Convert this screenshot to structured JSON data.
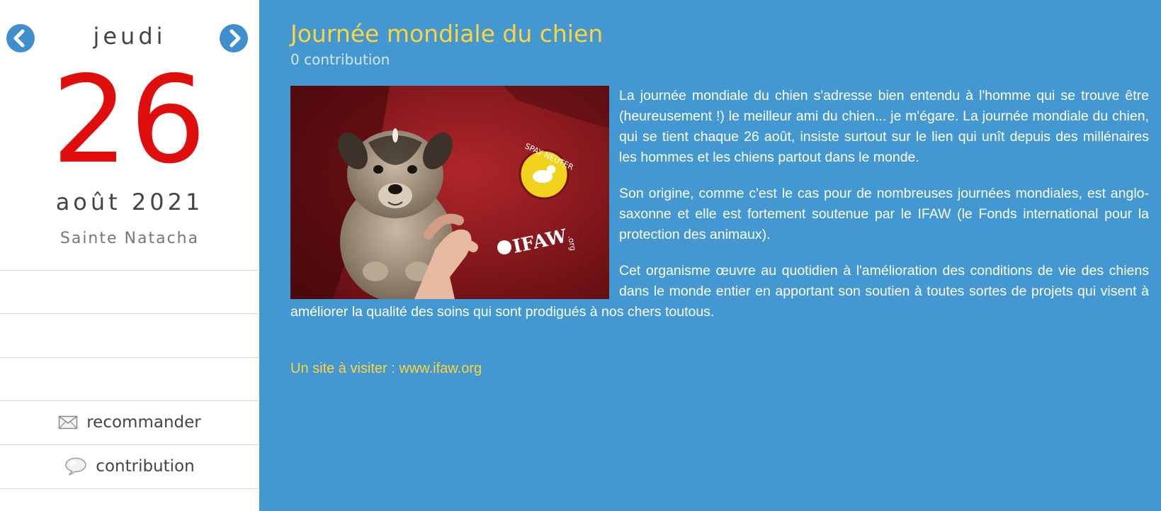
{
  "sidebar": {
    "weekday": "jeudi",
    "day": "26",
    "month_year": "août 2021",
    "saint": "Sainte Natacha",
    "actions": {
      "recommend": "recommander",
      "contribute": "contribution"
    }
  },
  "article": {
    "title": "Journée mondiale du chien",
    "contributions": "0 contribution",
    "paragraphs": [
      "La journée mondiale du chien s'adresse bien entendu à l'homme qui se trouve être (heureusement !) le meilleur ami du chien... je m'égare. La journée mondiale du chien, qui se tient chaque 26 août, insiste surtout sur le lien qui unît depuis des millénaires les hommes et les chiens partout dans le monde.",
      "Son origine, comme c'est le cas pour de nombreuses journées mondiales, est anglo-saxonne et elle est fortement soutenue par le IFAW (le Fonds international pour la protection des animaux).",
      "Cet organisme œuvre au quotidien à l'amélioration des conditions de vie des chiens dans le monde entier en apportant son soutien à toutes sortes de projets qui visent à améliorer la qualité des soins qui sont prodigués à nos chers toutous."
    ],
    "visit_prefix": "Un site à visiter : ",
    "visit_link": "www.ifaw.org",
    "photo": {
      "badge_text": "SPAY NEUTER",
      "logo_text": "IFAW",
      "logo_suffix": ".org"
    }
  },
  "colors": {
    "main_bg": "#4398d1",
    "title": "#ffd43b",
    "day_number": "#e00d0d",
    "nav_button": "#3f8fcf"
  }
}
